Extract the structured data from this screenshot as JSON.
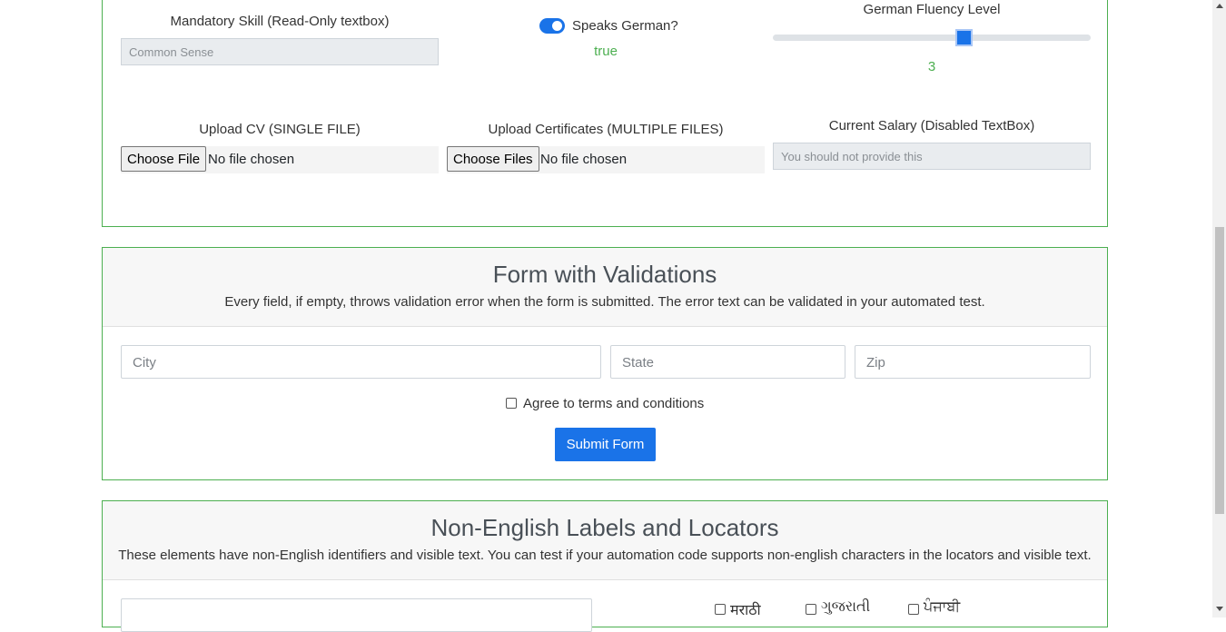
{
  "top_section": {
    "mandatory_skill_label": "Mandatory Skill (Read-Only textbox)",
    "mandatory_skill_value": "Common Sense",
    "speaks_german_label": "Speaks German?",
    "speaks_german_value": "true",
    "fluency_label": "German Fluency Level",
    "fluency_value": "3",
    "fluency_level_fraction": 0.6,
    "cv_label": "Upload CV (SINGLE FILE)",
    "cv_button": "Choose File",
    "cv_status": "No file chosen",
    "certs_label": "Upload Certificates (MULTIPLE FILES)",
    "certs_button": "Choose Files",
    "certs_status": "No file chosen",
    "salary_label": "Current Salary (Disabled TextBox)",
    "salary_placeholder": "You should not provide this"
  },
  "validations": {
    "title": "Form with Validations",
    "subtitle": "Every field, if empty, throws validation error when the form is submitted. The error text can be validated in your automated test.",
    "city_placeholder": "City",
    "state_placeholder": "State",
    "zip_placeholder": "Zip",
    "agree_label": "Agree to terms and conditions",
    "submit_label": "Submit Form"
  },
  "non_english": {
    "title": "Non-English Labels and Locators",
    "subtitle": "These elements have non-English identifiers and visible text. You can test if your automation code supports non-english characters in the locators and visible text.",
    "checkboxes": [
      "मराठी",
      "ગુજરાતી",
      "ਪੰਜਾਬੀ"
    ]
  },
  "colors": {
    "accent_green": "#4caf50",
    "primary_blue": "#1a73e8"
  }
}
